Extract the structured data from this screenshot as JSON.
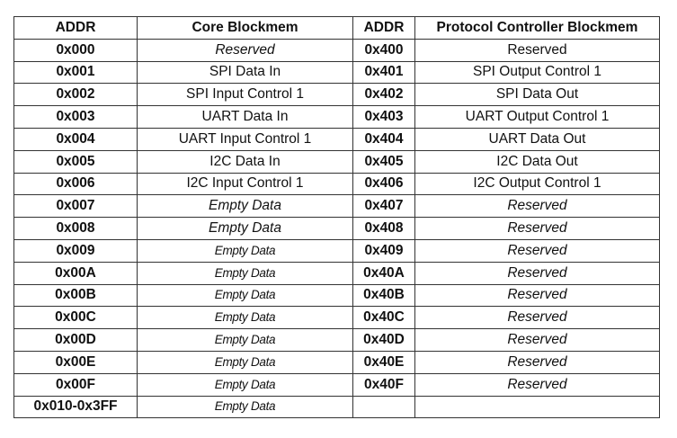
{
  "headers": [
    "ADDR",
    "Core Blockmem",
    "ADDR",
    "Protocol Controller Blockmem"
  ],
  "rows": [
    {
      "a1": "0x000",
      "c": "Reserved",
      "cs": "it",
      "a2": "0x400",
      "p": "Reserved",
      "ps": ""
    },
    {
      "a1": "0x001",
      "c": "SPI Data In",
      "cs": "",
      "a2": "0x401",
      "p": "SPI Output Control 1",
      "ps": ""
    },
    {
      "a1": "0x002",
      "c": "SPI Input Control 1",
      "cs": "",
      "a2": "0x402",
      "p": "SPI Data Out",
      "ps": ""
    },
    {
      "a1": "0x003",
      "c": "UART Data In",
      "cs": "",
      "a2": "0x403",
      "p": "UART Output Control 1",
      "ps": ""
    },
    {
      "a1": "0x004",
      "c": "UART Input Control 1",
      "cs": "",
      "a2": "0x404",
      "p": "UART Data Out",
      "ps": ""
    },
    {
      "a1": "0x005",
      "c": "I2C Data In",
      "cs": "",
      "a2": "0x405",
      "p": "I2C Data Out",
      "ps": ""
    },
    {
      "a1": "0x006",
      "c": "I2C Input Control 1",
      "cs": "",
      "a2": "0x406",
      "p": "I2C Output Control 1",
      "ps": ""
    },
    {
      "a1": "0x007",
      "c": "Empty Data",
      "cs": "it",
      "a2": "0x407",
      "p": "Reserved",
      "ps": "it"
    },
    {
      "a1": "0x008",
      "c": "Empty Data",
      "cs": "it",
      "a2": "0x408",
      "p": "Reserved",
      "ps": "it"
    },
    {
      "a1": "0x009",
      "c": "Empty Data",
      "cs": "cond",
      "a2": "0x409",
      "p": "Reserved",
      "ps": "it"
    },
    {
      "a1": "0x00A",
      "c": "Empty Data",
      "cs": "cond",
      "a2": "0x40A",
      "p": "Reserved",
      "ps": "it"
    },
    {
      "a1": "0x00B",
      "c": "Empty Data",
      "cs": "cond",
      "a2": "0x40B",
      "p": "Reserved",
      "ps": "it"
    },
    {
      "a1": "0x00C",
      "c": "Empty Data",
      "cs": "cond",
      "a2": "0x40C",
      "p": "Reserved",
      "ps": "it"
    },
    {
      "a1": "0x00D",
      "c": "Empty Data",
      "cs": "cond",
      "a2": "0x40D",
      "p": "Reserved",
      "ps": "it"
    },
    {
      "a1": "0x00E",
      "c": "Empty Data",
      "cs": "cond",
      "a2": "0x40E",
      "p": "Reserved",
      "ps": "it"
    },
    {
      "a1": "0x00F",
      "c": "Empty Data",
      "cs": "cond",
      "a2": "0x40F",
      "p": "Reserved",
      "ps": "it"
    },
    {
      "a1": "0x010-0x3FF",
      "c": "Empty Data",
      "cs": "cond",
      "a2": "",
      "p": "",
      "ps": ""
    }
  ]
}
